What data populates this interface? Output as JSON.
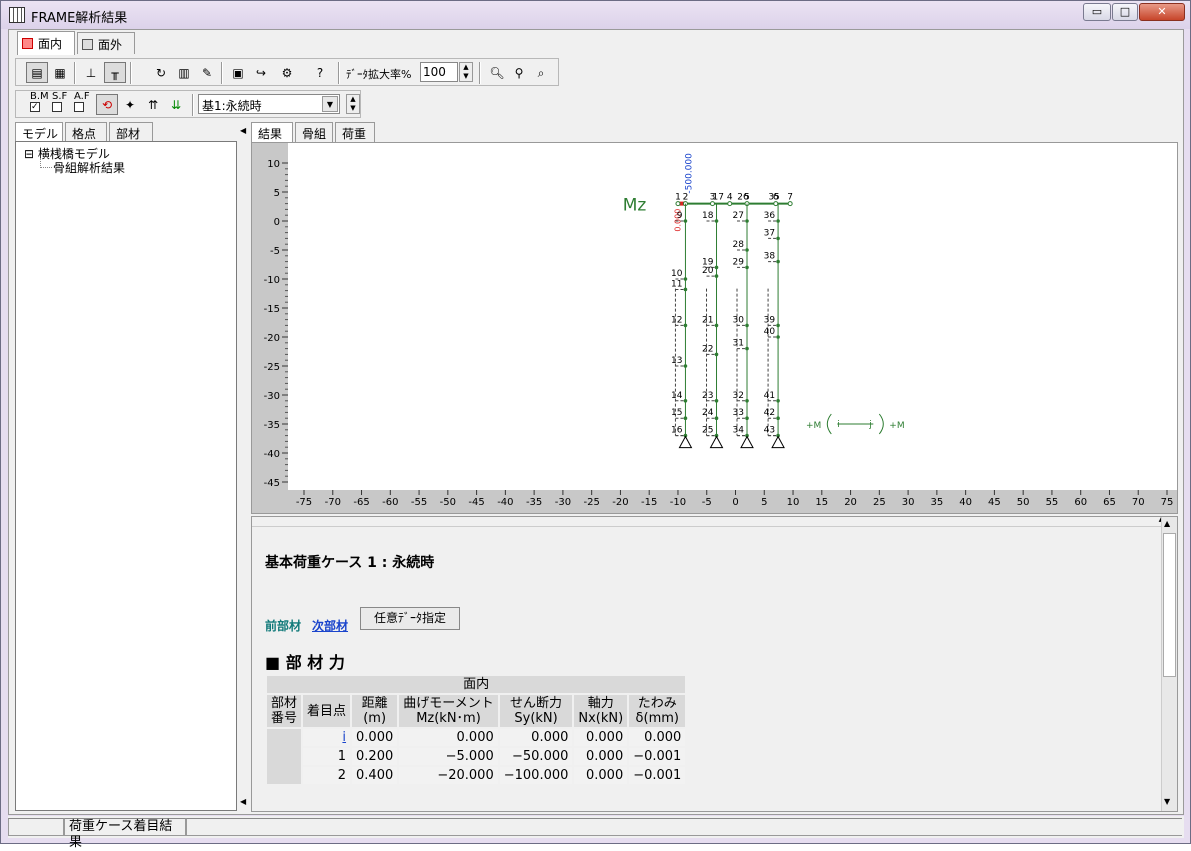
{
  "window": {
    "title": "FRAME解析結果",
    "minimize": "▭",
    "maximize": "□",
    "close": "✕"
  },
  "top_tabs": [
    {
      "label": "面内"
    },
    {
      "label": "面外"
    }
  ],
  "toolbar": {
    "zoom_label": "ﾃﾞｰﾀ拡大率%",
    "zoom_value": "100",
    "checks": {
      "bm": "B.M",
      "sf": "S.F",
      "af": "A.F"
    },
    "case_select": "基1:永続時"
  },
  "left_tabs": [
    {
      "label": "モデル"
    },
    {
      "label": "格点"
    },
    {
      "label": "部材"
    }
  ],
  "tree": {
    "root": "横桟橋モデル",
    "child": "骨組解析結果",
    "expander": "⊟"
  },
  "view_tabs": [
    {
      "label": "結果"
    },
    {
      "label": "骨組"
    },
    {
      "label": "荷重"
    }
  ],
  "chart_data": {
    "type": "other",
    "label": "Mz",
    "xlim": [
      -75,
      75
    ],
    "ylim": [
      -45,
      10
    ],
    "x_ticks": [
      -75,
      -70,
      -65,
      -60,
      -55,
      -50,
      -45,
      -40,
      -35,
      -30,
      -25,
      -20,
      -15,
      -10,
      -5,
      0,
      5,
      10,
      15,
      20,
      25,
      30,
      35,
      40,
      45,
      50,
      55,
      60,
      65,
      70,
      75
    ],
    "y_ticks": [
      10,
      5,
      0,
      -5,
      -10,
      -15,
      -20,
      -25,
      -30,
      -35,
      -40,
      -45
    ],
    "moment_value_label": "-500.000",
    "moment_small_label": "0.000",
    "deck_nodes": [
      {
        "label": "1",
        "x": -10.0,
        "y": 3
      },
      {
        "label": "2",
        "x": -8.7,
        "y": 3
      },
      {
        "label": "3",
        "x": -4.0,
        "y": 3
      },
      {
        "label": "4",
        "x": -1.0,
        "y": 3
      },
      {
        "label": "5",
        "x": 2.0,
        "y": 3
      },
      {
        "label": "6",
        "x": 7.0,
        "y": 3
      },
      {
        "label": "7",
        "x": 9.5,
        "y": 3
      }
    ],
    "top_labels": [
      {
        "label": "17",
        "x": -3.0,
        "y": 3
      },
      {
        "label": "26",
        "x": 1.3,
        "y": 3
      },
      {
        "label": "35",
        "x": 6.7,
        "y": 3
      }
    ],
    "piles": [
      {
        "x": -8.7,
        "nodes": [
          {
            "label": "9",
            "y": 0
          },
          {
            "label": "10",
            "y": -10
          },
          {
            "label": "11",
            "y": -11.8
          },
          {
            "label": "12",
            "y": -18
          },
          {
            "label": "13",
            "y": -25
          },
          {
            "label": "14",
            "y": -31
          },
          {
            "label": "15",
            "y": -34
          },
          {
            "label": "16",
            "y": -37
          }
        ]
      },
      {
        "x": -3.3,
        "nodes": [
          {
            "label": "18",
            "y": 0
          },
          {
            "label": "19",
            "y": -8
          },
          {
            "label": "20",
            "y": -9.5
          },
          {
            "label": "21",
            "y": -18
          },
          {
            "label": "22",
            "y": -23
          },
          {
            "label": "23",
            "y": -31
          },
          {
            "label": "24",
            "y": -34
          },
          {
            "label": "25",
            "y": -37
          }
        ]
      },
      {
        "x": 2.0,
        "nodes": [
          {
            "label": "27",
            "y": 0
          },
          {
            "label": "28",
            "y": -5
          },
          {
            "label": "29",
            "y": -8
          },
          {
            "label": "30",
            "y": -18
          },
          {
            "label": "31",
            "y": -22
          },
          {
            "label": "32",
            "y": -31
          },
          {
            "label": "33",
            "y": -34
          },
          {
            "label": "34",
            "y": -37
          }
        ]
      },
      {
        "x": 7.4,
        "nodes": [
          {
            "label": "36",
            "y": 0
          },
          {
            "label": "37",
            "y": -3
          },
          {
            "label": "38",
            "y": -7
          },
          {
            "label": "39",
            "y": -18
          },
          {
            "label": "40",
            "y": -20
          },
          {
            "label": "41",
            "y": -31
          },
          {
            "label": "42",
            "y": -34
          },
          {
            "label": "43",
            "y": -37
          }
        ]
      }
    ],
    "sign_legend": {
      "left": "+M",
      "right": "+M",
      "i": "i",
      "j": "j"
    }
  },
  "result": {
    "case_title": "基本荷重ケース 1 : 永続時",
    "prev_member": "前部材",
    "next_member": "次部材",
    "arbitrary_button": "任意ﾃﾞｰﾀ指定",
    "section_marker": "■",
    "section_title": "部 材 力",
    "table": {
      "group": "面内",
      "headers": [
        "部材\n番号",
        "着目点",
        "距離\n(m)",
        "曲げモーメント\nMz(kN･m)",
        "せん断力\nSy(kN)",
        "軸力\nNx(kN)",
        "たわみ\nδ(mm)"
      ],
      "rows": [
        [
          "i",
          "0.000",
          "0.000",
          "0.000",
          "0.000",
          "0.000"
        ],
        [
          "1",
          "0.200",
          "−5.000",
          "−50.000",
          "0.000",
          "−0.001"
        ],
        [
          "2",
          "0.400",
          "−20.000",
          "−100.000",
          "0.000",
          "−0.001"
        ]
      ]
    }
  },
  "status": {
    "text": "荷重ケース着目結果"
  }
}
